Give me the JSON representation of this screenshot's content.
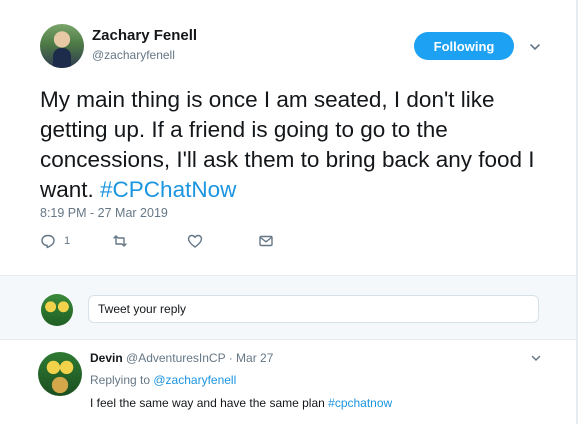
{
  "tweet": {
    "name": "Zachary Fenell",
    "handle": "@zacharyfenell",
    "follow_label": "Following",
    "text": "My main thing is once I am seated, I don't like getting up. If a friend is going to go to the concessions, I'll ask them to bring back any food I want. ",
    "hashtag": "#CPChatNow",
    "timestamp": "8:19 PM - 27 Mar 2019",
    "reply_count": "1"
  },
  "reply_box": {
    "placeholder": "Tweet your reply"
  },
  "reply": {
    "name": "Devin",
    "meta": " @AdventuresInCP · Mar 27",
    "replying_prefix": "Replying to ",
    "replying_to": "@zacharyfenell",
    "text": "I feel the same way and have the same plan ",
    "hashtag": "#cpchatnow"
  },
  "colors": {
    "accent": "#1da1f2",
    "link": "#1b95e0",
    "muted": "#657786"
  }
}
